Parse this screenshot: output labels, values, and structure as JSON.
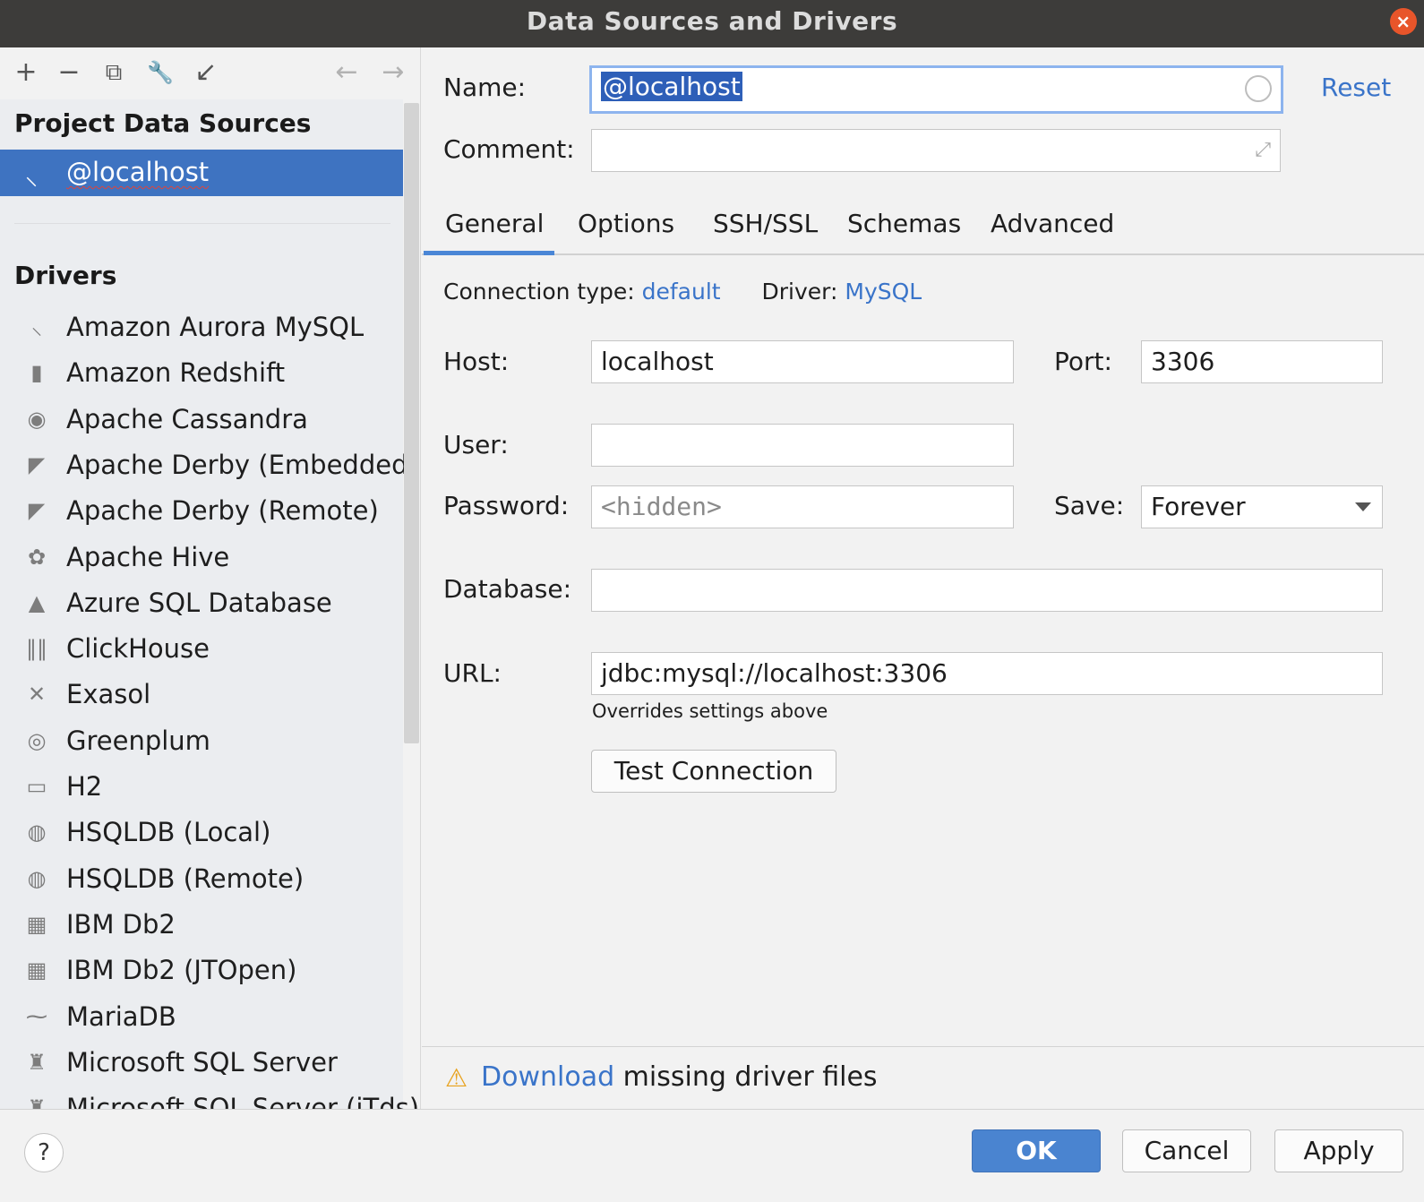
{
  "window": {
    "title": "Data Sources and Drivers",
    "close_glyph": "×"
  },
  "toolbar": {
    "icons": [
      {
        "name": "add-icon",
        "glyph": "+"
      },
      {
        "name": "remove-icon",
        "glyph": "−"
      },
      {
        "name": "duplicate-icon",
        "glyph": "⧉"
      },
      {
        "name": "wrench-icon",
        "glyph": "🔧"
      },
      {
        "name": "import-icon",
        "glyph": "↙"
      }
    ],
    "back_glyph": "←",
    "forward_glyph": "→"
  },
  "sidebar": {
    "project_title": "Project Data Sources",
    "selected_source": "@localhost",
    "drivers_title": "Drivers",
    "drivers": [
      {
        "label": "Amazon Aurora MySQL",
        "icon": "dolphin-icon",
        "glyph": "⸜"
      },
      {
        "label": "Amazon Redshift",
        "icon": "redshift-icon",
        "glyph": "▮"
      },
      {
        "label": "Apache Cassandra",
        "icon": "eye-icon",
        "glyph": "◉"
      },
      {
        "label": "Apache Derby (Embedded)",
        "icon": "hat-icon",
        "glyph": "◤"
      },
      {
        "label": "Apache Derby (Remote)",
        "icon": "hat-icon",
        "glyph": "◤"
      },
      {
        "label": "Apache Hive",
        "icon": "bee-icon",
        "glyph": "✿"
      },
      {
        "label": "Azure SQL Database",
        "icon": "azure-icon",
        "glyph": "▲"
      },
      {
        "label": "ClickHouse",
        "icon": "bars-icon",
        "glyph": "‖‖"
      },
      {
        "label": "Exasol",
        "icon": "x-icon",
        "glyph": "✕"
      },
      {
        "label": "Greenplum",
        "icon": "circle-icon",
        "glyph": "◎"
      },
      {
        "label": "H2",
        "icon": "h2-icon",
        "glyph": "▭"
      },
      {
        "label": "HSQLDB (Local)",
        "icon": "magnifier-icon",
        "glyph": "◍"
      },
      {
        "label": "HSQLDB (Remote)",
        "icon": "magnifier-icon",
        "glyph": "◍"
      },
      {
        "label": "IBM Db2",
        "icon": "ibm-icon",
        "glyph": "▦"
      },
      {
        "label": "IBM Db2 (JTOpen)",
        "icon": "ibm-icon",
        "glyph": "▦"
      },
      {
        "label": "MariaDB",
        "icon": "seal-icon",
        "glyph": "⁓"
      },
      {
        "label": "Microsoft SQL Server",
        "icon": "sqlserver-icon",
        "glyph": "♜"
      },
      {
        "label": "Microsoft SQL Server (jTds)",
        "icon": "sqlserver-icon",
        "glyph": "♜"
      }
    ]
  },
  "form": {
    "name_label": "Name:",
    "name_value": "@localhost",
    "reset_label": "Reset",
    "comment_label": "Comment:",
    "comment_value": "",
    "tabs": [
      "General",
      "Options",
      "SSH/SSL",
      "Schemas",
      "Advanced"
    ],
    "connection_type_label": "Connection type:",
    "connection_type_value": "default",
    "driver_label": "Driver:",
    "driver_value": "MySQL",
    "host_label": "Host:",
    "host_value": "localhost",
    "port_label": "Port:",
    "port_value": "3306",
    "user_label": "User:",
    "user_value": "",
    "password_label": "Password:",
    "password_placeholder": "<hidden>",
    "save_label": "Save:",
    "save_value": "Forever",
    "database_label": "Database:",
    "database_value": "",
    "url_label": "URL:",
    "url_value": "jdbc:mysql://localhost:3306",
    "url_hint": "Overrides settings above",
    "test_connection_label": "Test Connection",
    "download_link": "Download",
    "download_rest": "missing driver files"
  },
  "footer": {
    "help_glyph": "?",
    "ok_label": "OK",
    "cancel_label": "Cancel",
    "apply_label": "Apply"
  },
  "colors": {
    "accent": "#3e73c1",
    "link": "#3a74c9",
    "warning": "#e8a21d",
    "titlebar": "#3d3c3a"
  }
}
